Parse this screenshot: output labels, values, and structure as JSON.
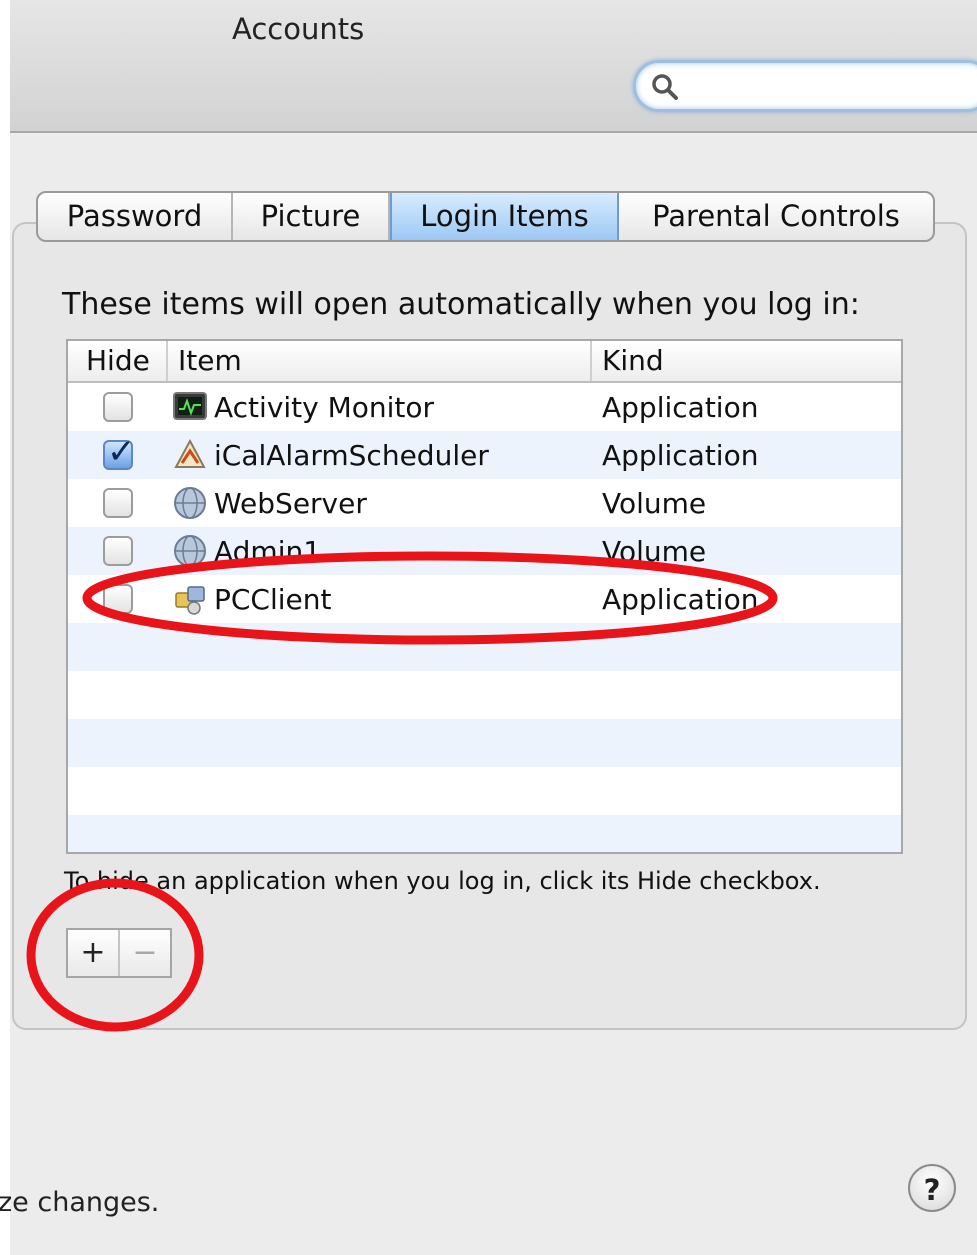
{
  "window": {
    "title": "Accounts"
  },
  "search": {
    "placeholder": "",
    "value": ""
  },
  "tabs": [
    {
      "label": "Password",
      "selected": false
    },
    {
      "label": "Picture",
      "selected": false
    },
    {
      "label": "Login Items",
      "selected": true
    },
    {
      "label": "Parental Controls",
      "selected": false
    }
  ],
  "login_items": {
    "instructions": "These items will open automatically when you log in:",
    "columns": {
      "hide": "Hide",
      "item": "Item",
      "kind": "Kind"
    },
    "rows": [
      {
        "hide": false,
        "icon": "activity-monitor-icon",
        "item": "Activity Monitor",
        "kind": "Application"
      },
      {
        "hide": true,
        "icon": "ical-alarm-scheduler-icon",
        "item": "iCalAlarmScheduler",
        "kind": "Application"
      },
      {
        "hide": false,
        "icon": "network-volume-icon",
        "item": "WebServer",
        "kind": "Volume"
      },
      {
        "hide": false,
        "icon": "network-volume-icon",
        "item": "Admin1",
        "kind": "Volume"
      },
      {
        "hide": false,
        "icon": "pcclient-icon",
        "item": "PCClient",
        "kind": "Application"
      }
    ],
    "hint": "To hide an application when you log in, click its Hide checkbox.",
    "add_label": "+",
    "remove_label": "−"
  },
  "footer": {
    "text": "ze changes.",
    "help_label": "?"
  },
  "colors": {
    "annotation": "#e8141a",
    "selected_tab": "#9cc8f4",
    "row_stripe": "#edf3fd"
  }
}
